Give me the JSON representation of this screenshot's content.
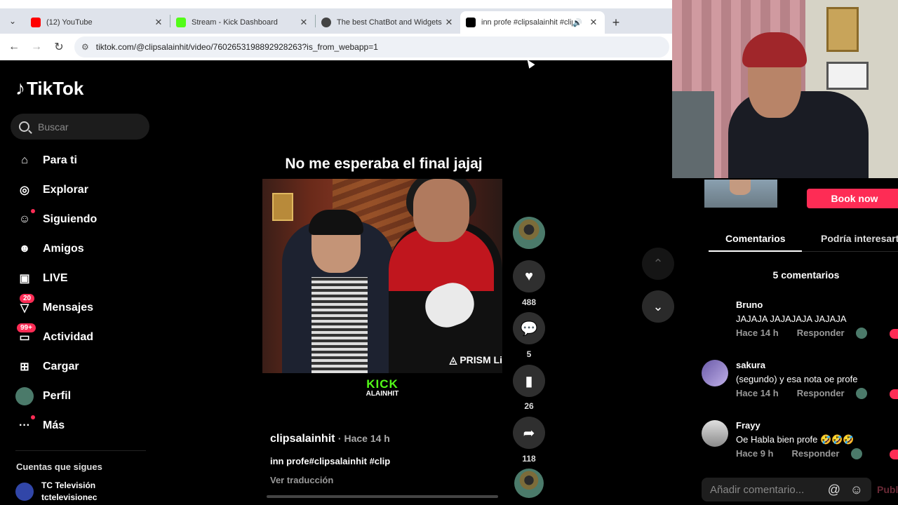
{
  "browser": {
    "tabs": [
      {
        "label": "(12) YouTube",
        "icon": "youtube-icon",
        "color": "#ff0000"
      },
      {
        "label": "Stream - Kick Dashboard",
        "icon": "kick-icon",
        "color": "#53fc18"
      },
      {
        "label": "The best ChatBot and Widgets",
        "icon": "chatbot-icon",
        "color": "#444444"
      },
      {
        "label": "inn profe #clipsalainhit #clip",
        "icon": "tiktok-icon",
        "color": "#000000"
      }
    ],
    "url": "tiktok.com/@clipsalainhit/video/7602653198892928263?is_from_webapp=1"
  },
  "sidebar": {
    "logo": "TikTok",
    "search_placeholder": "Buscar",
    "nav": [
      {
        "label": "Para ti",
        "icon": "home-icon"
      },
      {
        "label": "Explorar",
        "icon": "compass-icon"
      },
      {
        "label": "Siguiendo",
        "icon": "following-icon"
      },
      {
        "label": "Amigos",
        "icon": "friends-icon"
      },
      {
        "label": "LIVE",
        "icon": "live-icon"
      },
      {
        "label": "Mensajes",
        "icon": "messages-icon",
        "badge": "20"
      },
      {
        "label": "Actividad",
        "icon": "activity-icon",
        "badge": "99+"
      },
      {
        "label": "Cargar",
        "icon": "upload-icon"
      },
      {
        "label": "Perfil",
        "icon": "profile-avatar"
      },
      {
        "label": "Más",
        "icon": "more-icon"
      }
    ],
    "following_title": "Cuentas que sigues",
    "following": [
      {
        "name": "TC Televisión",
        "handle": "tctelevisionec"
      }
    ]
  },
  "video": {
    "title": "No me esperaba el final jajaj",
    "watermark": "PRISM Li",
    "kick_top": "KICK",
    "kick_bottom": "ALAINHIT",
    "author": "clipsalainhit",
    "time": "· Hace 14 h",
    "description": "inn profe#clipsalainhit #clip",
    "translate": "Ver traducción",
    "likes": "488",
    "comments": "5",
    "saves": "26",
    "shares": "118"
  },
  "comments_panel": {
    "ad_button": "Book now",
    "tab_comments": "Comentarios",
    "tab_other": "Podría interesarte",
    "count": "5 comentarios",
    "comments": [
      {
        "name": "Bruno",
        "text": "JAJAJA JAJAJAJA JAJAJA",
        "time": "Hace 14 h",
        "reply": "Responder"
      },
      {
        "name": "sakura",
        "text": "(segundo) y esa nota oe profe",
        "time": "Hace 14 h",
        "reply": "Responder"
      },
      {
        "name": "Frayy",
        "text": "Oe Habla bien profe 🤣🤣🤣",
        "time": "Hace 9 h",
        "reply": "Responder"
      }
    ],
    "input_placeholder": "Añadir comentario...",
    "post_label": "Publ"
  }
}
